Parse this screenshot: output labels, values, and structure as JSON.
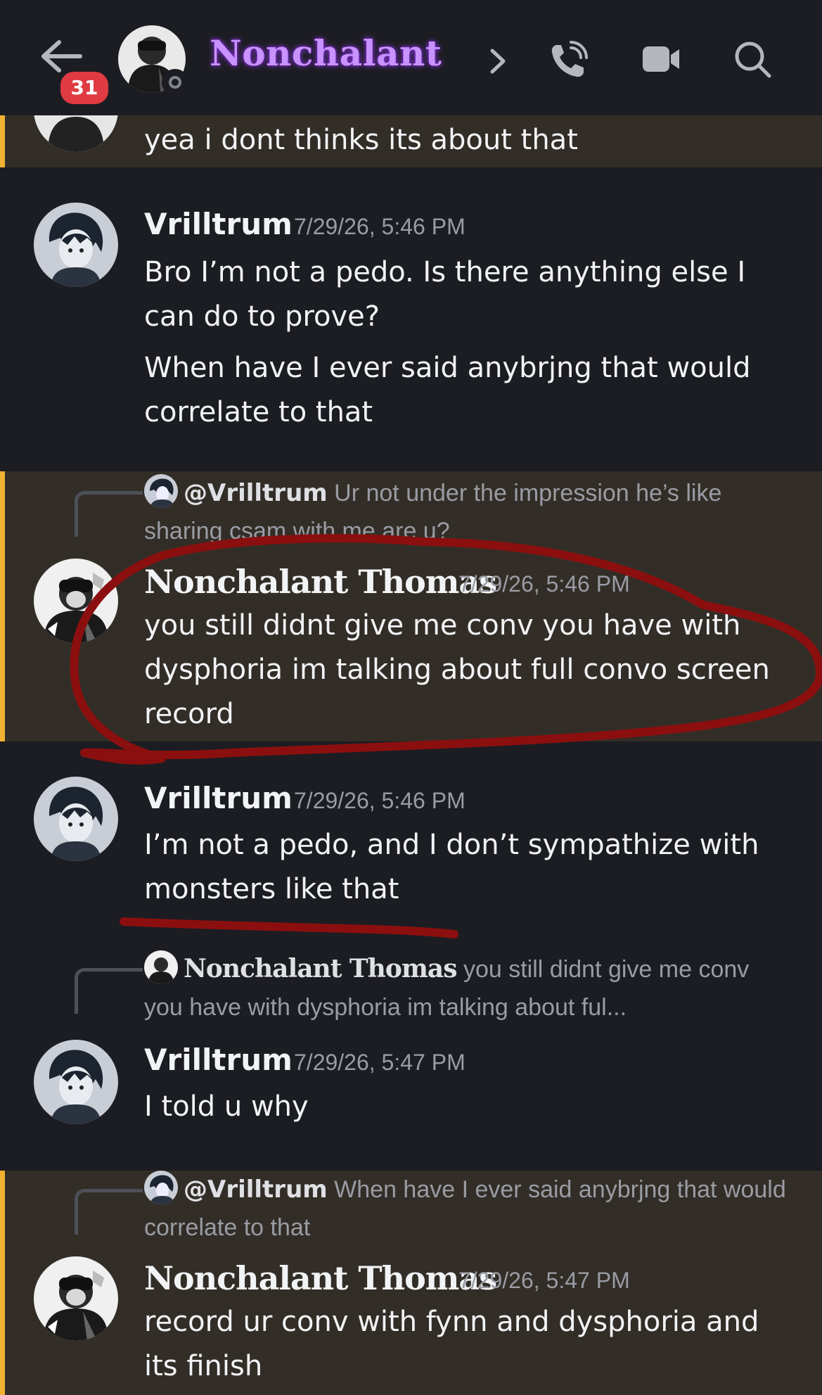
{
  "header": {
    "channel_name": "Nonchalant",
    "unread_count": "31"
  },
  "messages": [
    {
      "text": "yea i dont thinks its about that",
      "highlighted": true
    },
    {
      "author": "Vrilltrum",
      "timestamp": "7/29/26, 5:46 PM",
      "lines": [
        "Bro I’m not a pedo. Is there anything else I can do to prove?",
        "When have I ever said anybrjng that would correlate to that"
      ]
    },
    {
      "reply_to": {
        "name": "@Vrilltrum",
        "text": "Ur not under the impression he’s like sharing csam with me are u?"
      },
      "author": "Nonchalant Thomas",
      "timestamp": "7/29/26, 5:46 PM",
      "text": "you still didnt give me conv you have with dysphoria im talking about full convo screen record",
      "highlighted": true
    },
    {
      "author": "Vrilltrum",
      "timestamp": "7/29/26, 5:46 PM",
      "text": "I’m not a pedo, and I don’t sympathize with monsters like that"
    },
    {
      "reply_to": {
        "name": "Nonchalant Thomas",
        "text": "you still didnt give me conv you have with dysphoria im talking about ful..."
      },
      "author": "Vrilltrum",
      "timestamp": "7/29/26, 5:47 PM",
      "text": "I told u why"
    },
    {
      "reply_to": {
        "name": "@Vrilltrum",
        "text": "When have I ever said anybrjng that would correlate to that"
      },
      "author": "Nonchalant Thomas",
      "timestamp": "7/29/26, 5:47 PM",
      "text": "record ur conv with fynn and dysphoria and its finish",
      "highlighted": true
    }
  ],
  "annotation_color": "#8b0f0f",
  "accent_colors": {
    "highlight_bar": "#f0b132",
    "badge": "#e03b42",
    "channel_glow": "#9a3bff"
  }
}
